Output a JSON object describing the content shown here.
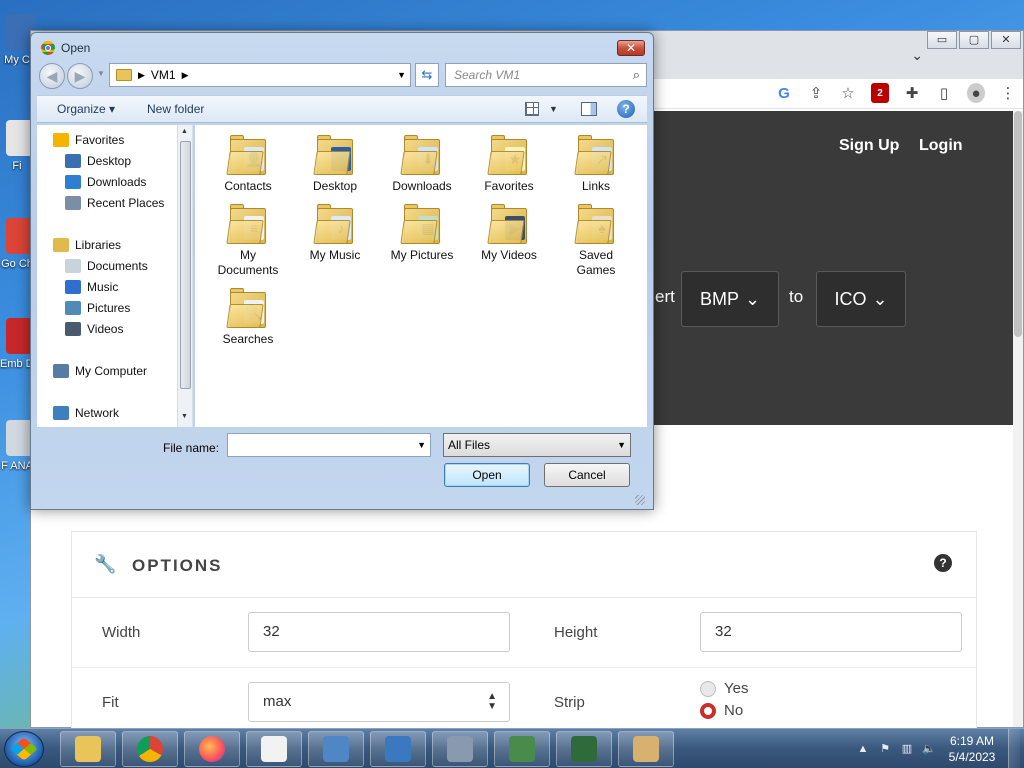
{
  "desktop": {
    "icons": [
      {
        "label": "My C",
        "color": "#3b6fb5"
      },
      {
        "label": "Fi",
        "color": "#e5e5e5"
      },
      {
        "label": "Go Ch",
        "color": "#db4437"
      },
      {
        "label": "Emb De",
        "color": "#c62828"
      },
      {
        "label": "F ANA",
        "color": "#d0d8e0"
      }
    ]
  },
  "browser": {
    "tab_dropdown_icon": "chevron-down-icon",
    "window_controls": [
      "▭",
      "▢",
      "✕"
    ],
    "toolbar_icons": [
      "google-icon",
      "share-icon",
      "star-icon",
      "ublock-icon",
      "extensions-icon",
      "sidepanel-icon",
      "profile-icon",
      "more-icon"
    ],
    "ublock_badge": "2",
    "hero": {
      "signup": "Sign Up",
      "login": "Login",
      "convert_word": "ert",
      "from_format": "BMP",
      "to_word": "to",
      "to_format": "ICO"
    },
    "options": {
      "title": "OPTIONS",
      "width_label": "Width",
      "width_value": "32",
      "height_label": "Height",
      "height_value": "32",
      "fit_label": "Fit",
      "fit_value": "max",
      "strip_label": "Strip",
      "strip_yes": "Yes",
      "strip_no": "No",
      "strip_selected": "No"
    }
  },
  "dialog": {
    "title": "Open",
    "breadcrumb": "VM1",
    "search_placeholder": "Search VM1",
    "organize": "Organize",
    "new_folder": "New folder",
    "nav": [
      {
        "label": "Favorites",
        "icon": "star-icon",
        "color": "#f4b400"
      },
      {
        "label": "Desktop",
        "icon": "desktop-icon",
        "color": "#3a6fb0"
      },
      {
        "label": "Downloads",
        "icon": "downloads-icon",
        "color": "#2f7fd0"
      },
      {
        "label": "Recent Places",
        "icon": "recent-places-icon",
        "color": "#7a8ea6"
      },
      {
        "label": "Libraries",
        "icon": "libraries-icon",
        "color": "#e1b94e"
      },
      {
        "label": "Documents",
        "icon": "documents-icon",
        "color": "#c9d2dd"
      },
      {
        "label": "Music",
        "icon": "music-icon",
        "color": "#2f6fd0"
      },
      {
        "label": "Pictures",
        "icon": "pictures-icon",
        "color": "#4f8ab8"
      },
      {
        "label": "Videos",
        "icon": "videos-icon",
        "color": "#4a5a6e"
      },
      {
        "label": "My Computer",
        "icon": "computer-icon",
        "color": "#5a7aa6"
      },
      {
        "label": "Network",
        "icon": "network-icon",
        "color": "#3f7fc0"
      }
    ],
    "files": [
      {
        "name": "Contacts",
        "badge": "👤",
        "badge_bg": "#dbe8f6"
      },
      {
        "name": "Desktop",
        "badge": "",
        "badge_bg": "#2b5ea8"
      },
      {
        "name": "Downloads",
        "badge": "⬇",
        "badge_bg": "#cfe3fb"
      },
      {
        "name": "Favorites",
        "badge": "★",
        "badge_bg": "#fff3c4"
      },
      {
        "name": "Links",
        "badge": "↗",
        "badge_bg": "#cfe3fb"
      },
      {
        "name": "My Documents",
        "badge": "≡",
        "badge_bg": "#eef1f5"
      },
      {
        "name": "My Music",
        "badge": "♪",
        "badge_bg": "#d9e9ff"
      },
      {
        "name": "My Pictures",
        "badge": "▦",
        "badge_bg": "#bfe0c4"
      },
      {
        "name": "My Videos",
        "badge": "▶",
        "badge_bg": "#3b4e6a"
      },
      {
        "name": "Saved Games",
        "badge": "♠",
        "badge_bg": "#e8e0c8"
      },
      {
        "name": "Searches",
        "badge": "🔍",
        "badge_bg": "#eef1f5"
      }
    ],
    "file_name_label": "File name:",
    "file_name_value": "",
    "file_type": "All Files",
    "open_button": "Open",
    "cancel_button": "Cancel"
  },
  "taskbar": {
    "apps": [
      {
        "name": "explorer",
        "color": "#e8c45a"
      },
      {
        "name": "chrome",
        "color": "#db4437"
      },
      {
        "name": "firefox",
        "color": "#ff7139"
      },
      {
        "name": "notepad",
        "color": "#f2f2f2"
      },
      {
        "name": "control-panel",
        "color": "#4f86c6"
      },
      {
        "name": "remote-desktop",
        "color": "#3a78c0"
      },
      {
        "name": "server-manager",
        "color": "#8a9aae"
      },
      {
        "name": "network-monitor",
        "color": "#4a8a4a"
      },
      {
        "name": "terminal-app",
        "color": "#2e6a3a"
      },
      {
        "name": "paint",
        "color": "#d8b070"
      }
    ],
    "time": "6:19 AM",
    "date": "5/4/2023"
  }
}
